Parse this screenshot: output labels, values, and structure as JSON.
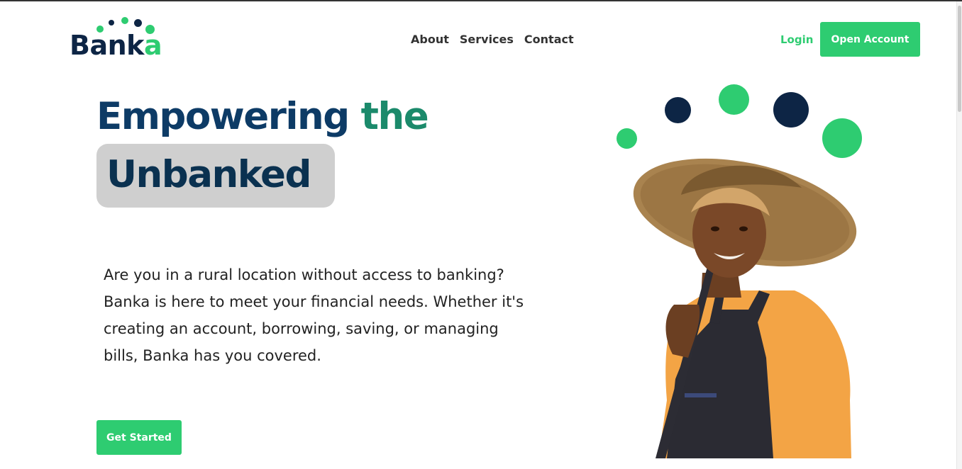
{
  "brand": {
    "name_prefix": "Ba",
    "name_mid": "nk",
    "name_suffix": "a",
    "primary_color": "#0d2545",
    "accent_color": "#2ecc71"
  },
  "nav": {
    "items": [
      {
        "label": "About"
      },
      {
        "label": "Services"
      },
      {
        "label": "Contact"
      }
    ]
  },
  "header": {
    "login_label": "Login",
    "open_account_label": "Open Account"
  },
  "hero": {
    "title_word1": "Empowering",
    "title_word2": "the",
    "title_highlight": "Unbanked",
    "description_lines": [
      "Are you in a rural location without access to banking?",
      "Banka is here to meet your financial needs. Whether it's",
      "creating an account, borrowing, saving, or managing",
      "bills, Banka has you covered."
    ],
    "cta_label": "Get Started"
  },
  "illustration": {
    "subject": "smiling-woman-straw-hat-apron"
  }
}
